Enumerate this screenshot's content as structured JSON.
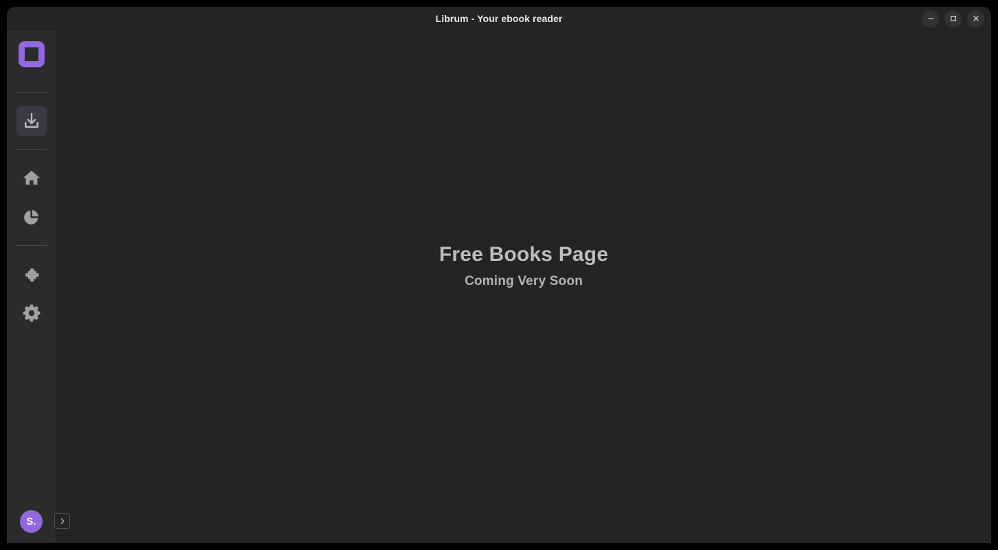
{
  "window": {
    "title": "Librum - Your ebook reader",
    "controls": [
      {
        "name": "minimize-button",
        "icon": "minimize-icon",
        "label": "Minimize"
      },
      {
        "name": "maximize-button",
        "icon": "maximize-icon",
        "label": "Maximize"
      },
      {
        "name": "close-button",
        "icon": "close-icon",
        "label": "Close"
      }
    ]
  },
  "sidebar": {
    "logo": {
      "icon": "librum-logo-icon",
      "label": "Librum",
      "color": "#9168de"
    },
    "items": [
      {
        "id": "free-books",
        "icon": "download-icon",
        "label": "Free Books",
        "active": true
      },
      {
        "id": "home",
        "icon": "home-icon",
        "label": "Home",
        "active": false
      },
      {
        "id": "statistics",
        "icon": "pie-chart-icon",
        "label": "Statistics",
        "active": false
      },
      {
        "id": "add-ons",
        "icon": "puzzle-piece-icon",
        "label": "Add-ons",
        "active": false
      },
      {
        "id": "settings",
        "icon": "gear-icon",
        "label": "Settings",
        "active": false
      }
    ],
    "account": {
      "avatar_initials": "S.",
      "avatar_color": "#9168de",
      "expand_icon": "chevron-right-icon",
      "expand_label": "Expand sidebar"
    }
  },
  "main": {
    "headline": "Free Books Page",
    "subline": "Coming Very Soon"
  }
}
